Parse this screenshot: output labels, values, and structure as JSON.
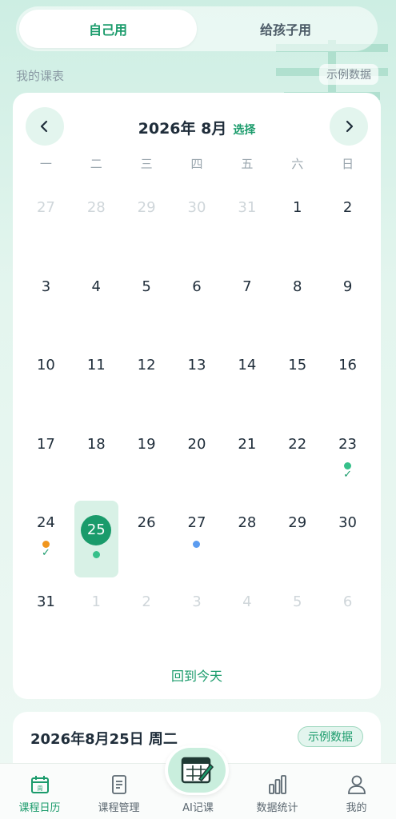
{
  "toggle": {
    "self": "自己用",
    "child": "给孩子用"
  },
  "section": {
    "label": "我的课表",
    "sample_tag": "示例数据"
  },
  "calendar": {
    "month_title": "2026年 8月",
    "pick_label": "选择",
    "weekdays": [
      "一",
      "二",
      "三",
      "四",
      "五",
      "六",
      "日"
    ],
    "days": [
      {
        "d": "27",
        "muted": true
      },
      {
        "d": "28",
        "muted": true
      },
      {
        "d": "29",
        "muted": true
      },
      {
        "d": "30",
        "muted": true
      },
      {
        "d": "31",
        "muted": true
      },
      {
        "d": "1"
      },
      {
        "d": "2"
      },
      {
        "d": "3"
      },
      {
        "d": "4"
      },
      {
        "d": "5"
      },
      {
        "d": "6"
      },
      {
        "d": "7"
      },
      {
        "d": "8"
      },
      {
        "d": "9"
      },
      {
        "d": "10"
      },
      {
        "d": "11"
      },
      {
        "d": "12"
      },
      {
        "d": "13"
      },
      {
        "d": "14"
      },
      {
        "d": "15"
      },
      {
        "d": "16"
      },
      {
        "d": "17"
      },
      {
        "d": "18"
      },
      {
        "d": "19"
      },
      {
        "d": "20"
      },
      {
        "d": "21"
      },
      {
        "d": "22"
      },
      {
        "d": "23",
        "dot": "#36c08a",
        "check": true
      },
      {
        "d": "24",
        "dot": "#f0961e",
        "check": true
      },
      {
        "d": "25",
        "dot": "#36c08a",
        "selected": true
      },
      {
        "d": "26"
      },
      {
        "d": "27",
        "dot": "#5b9cf0"
      },
      {
        "d": "28"
      },
      {
        "d": "29"
      },
      {
        "d": "30"
      },
      {
        "d": "31"
      },
      {
        "d": "1",
        "muted": true
      },
      {
        "d": "2",
        "muted": true
      },
      {
        "d": "3",
        "muted": true
      },
      {
        "d": "4",
        "muted": true
      },
      {
        "d": "5",
        "muted": true
      },
      {
        "d": "6",
        "muted": true
      }
    ],
    "back_today": "回到今天"
  },
  "day_card": {
    "title": "2026年8月25日 周二",
    "sample_tag": "示例数据"
  },
  "tabbar": {
    "tabs": [
      {
        "label": "课程日历",
        "icon": "calendar-icon",
        "active": true
      },
      {
        "label": "课程管理",
        "icon": "document-icon"
      },
      {
        "label": "AI记课",
        "icon": "ai-note-icon"
      },
      {
        "label": "数据统计",
        "icon": "bar-chart-icon"
      },
      {
        "label": "我的",
        "icon": "user-icon"
      }
    ]
  },
  "colors": {
    "accent": "#1a9b6b",
    "selected_bg": "#d8f1e6"
  }
}
